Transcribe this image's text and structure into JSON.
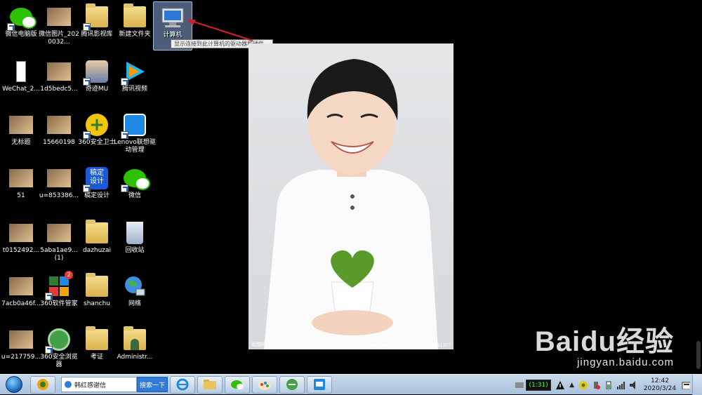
{
  "desktop_icons": [
    {
      "label": "微信电脑版",
      "icon": "wechat-icon"
    },
    {
      "label": "微信图片_2020032...",
      "icon": "image-thumbnail-icon"
    },
    {
      "label": "腾讯影视库",
      "icon": "folder-icon"
    },
    {
      "label": "新建文件夹",
      "icon": "folder-icon"
    },
    {
      "label": "计算机",
      "icon": "computer-icon"
    },
    {
      "label": "WeChat_2...",
      "icon": "phone-image-icon"
    },
    {
      "label": "1d5bedc5...",
      "icon": "image-thumbnail-icon"
    },
    {
      "label": "奇迹MU",
      "icon": "game-icon"
    },
    {
      "label": "腾讯视频",
      "icon": "tencent-video-icon"
    },
    {
      "label": "无标题",
      "icon": "image-thumbnail-icon"
    },
    {
      "label": "15660198",
      "icon": "image-thumbnail-icon"
    },
    {
      "label": "360安全卫士",
      "icon": "360-safe-icon"
    },
    {
      "label": "Lenovo联想驱动管理",
      "icon": "lenovo-driver-icon"
    },
    {
      "label": "51",
      "icon": "image-thumbnail-icon"
    },
    {
      "label": "u=853386...",
      "icon": "image-thumbnail-icon"
    },
    {
      "label": "稿定设计",
      "icon": "gaoding-design-icon"
    },
    {
      "label": "微信",
      "icon": "wechat-icon"
    },
    {
      "label": "t0152492...",
      "icon": "image-thumbnail-icon"
    },
    {
      "label": "5aba1ae9... (1)",
      "icon": "image-thumbnail-icon"
    },
    {
      "label": "dazhuzai",
      "icon": "folder-icon"
    },
    {
      "label": "回收站",
      "icon": "recycle-bin-icon"
    },
    {
      "label": "7acb0a46f...",
      "icon": "image-thumbnail-icon"
    },
    {
      "label": "360软件管家",
      "icon": "360-software-icon"
    },
    {
      "label": "shanchu",
      "icon": "folder-icon"
    },
    {
      "label": "网络",
      "icon": "network-icon"
    },
    {
      "label": "u=217759...",
      "icon": "image-thumbnail-icon"
    },
    {
      "label": "360安全浏览器",
      "icon": "360-browser-icon"
    },
    {
      "label": "考证",
      "icon": "folder-icon"
    },
    {
      "label": "Administr...",
      "icon": "user-folder-icon"
    }
  ],
  "tooltip": "显示连接到此计算机的驱动器和硬件。",
  "badge_360_software": "2",
  "photo": {
    "subject": "smiling boy in white shirt holding heart-shaped moss plant",
    "caption_left": "昵图网 www.nipic.com",
    "caption_right": "By:Yvonne_HMK No:20150707133634081357"
  },
  "watermark": {
    "logo": "Baidu经验",
    "url": "jingyan.baidu.com"
  },
  "taskbar": {
    "search_text": "韩红感谢信",
    "search_button": "搜索一下",
    "battery": "(1:31)",
    "time": "12:42",
    "date": "2020/3/24"
  },
  "colors": {
    "desktop_bg": "#000000",
    "taskbar": "#b9cfe6",
    "selection": "#8caadc",
    "arrow": "#d0202a"
  }
}
